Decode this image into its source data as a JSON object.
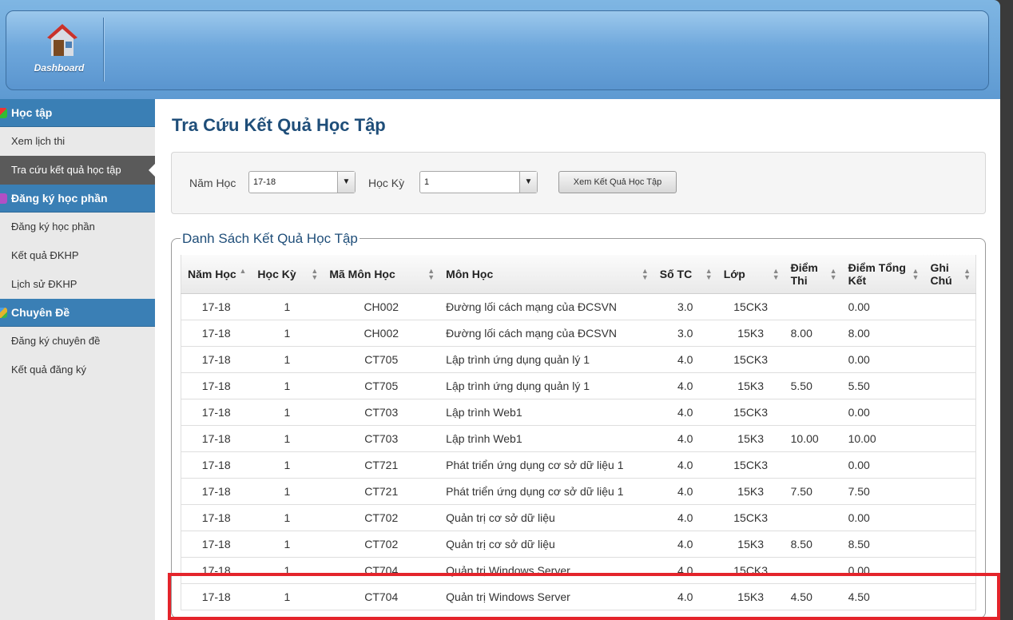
{
  "header": {
    "dashboard_label": "Dashboard"
  },
  "sidebar": {
    "sections": [
      {
        "title": "Học tập",
        "icon": "study-icon",
        "items": [
          "Xem lịch thi",
          "Tra cứu kết quả học tập"
        ]
      },
      {
        "title": "Đăng ký học phần",
        "icon": "list-icon",
        "items": [
          "Đăng ký học phần",
          "Kết quả ĐKHP",
          "Lịch sử ĐKHP"
        ]
      },
      {
        "title": "Chuyên Đề",
        "icon": "topic-icon",
        "items": [
          "Đăng ký chuyên đề",
          "Kết quả đăng ký"
        ]
      }
    ],
    "active_item": "Tra cứu kết quả học tập"
  },
  "page": {
    "title": "Tra Cứu Kết Quả Học Tập"
  },
  "filter": {
    "year_label": "Năm Học",
    "year_value": "17-18",
    "term_label": "Học Kỳ",
    "term_value": "1",
    "submit_label": "Xem Kết Quả Học Tập"
  },
  "results": {
    "legend": "Danh Sách Kết Quả Học Tập",
    "columns": [
      "Năm Học",
      "Học Kỳ",
      "Mã Môn Học",
      "Môn Học",
      "Số TC",
      "Lớp",
      "Điểm Thi",
      "Điểm Tổng Kết",
      "Ghi Chú"
    ],
    "rows": [
      [
        "17-18",
        "1",
        "CH002",
        "Đường lối cách mạng của ĐCSVN",
        "3.0",
        "15CK3",
        "",
        "0.00",
        ""
      ],
      [
        "17-18",
        "1",
        "CH002",
        "Đường lối cách mạng của ĐCSVN",
        "3.0",
        "15K3",
        "8.00",
        "8.00",
        ""
      ],
      [
        "17-18",
        "1",
        "CT705",
        "Lập trình ứng dụng quản lý 1",
        "4.0",
        "15CK3",
        "",
        "0.00",
        ""
      ],
      [
        "17-18",
        "1",
        "CT705",
        "Lập trình ứng dụng quản lý 1",
        "4.0",
        "15K3",
        "5.50",
        "5.50",
        ""
      ],
      [
        "17-18",
        "1",
        "CT703",
        "Lập trình Web1",
        "4.0",
        "15CK3",
        "",
        "0.00",
        ""
      ],
      [
        "17-18",
        "1",
        "CT703",
        "Lập trình Web1",
        "4.0",
        "15K3",
        "10.00",
        "10.00",
        ""
      ],
      [
        "17-18",
        "1",
        "CT721",
        "Phát triển ứng dụng cơ sở dữ liệu 1",
        "4.0",
        "15CK3",
        "",
        "0.00",
        ""
      ],
      [
        "17-18",
        "1",
        "CT721",
        "Phát triển ứng dụng cơ sở dữ liệu 1",
        "4.0",
        "15K3",
        "7.50",
        "7.50",
        ""
      ],
      [
        "17-18",
        "1",
        "CT702",
        "Quản trị cơ sở dữ liệu",
        "4.0",
        "15CK3",
        "",
        "0.00",
        ""
      ],
      [
        "17-18",
        "1",
        "CT702",
        "Quản trị cơ sở dữ liệu",
        "4.0",
        "15K3",
        "8.50",
        "8.50",
        ""
      ],
      [
        "17-18",
        "1",
        "CT704",
        "Quản trị Windows Server",
        "4.0",
        "15CK3",
        "",
        "0.00",
        ""
      ],
      [
        "17-18",
        "1",
        "CT704",
        "Quản trị Windows Server",
        "4.0",
        "15K3",
        "4.50",
        "4.50",
        ""
      ]
    ]
  }
}
